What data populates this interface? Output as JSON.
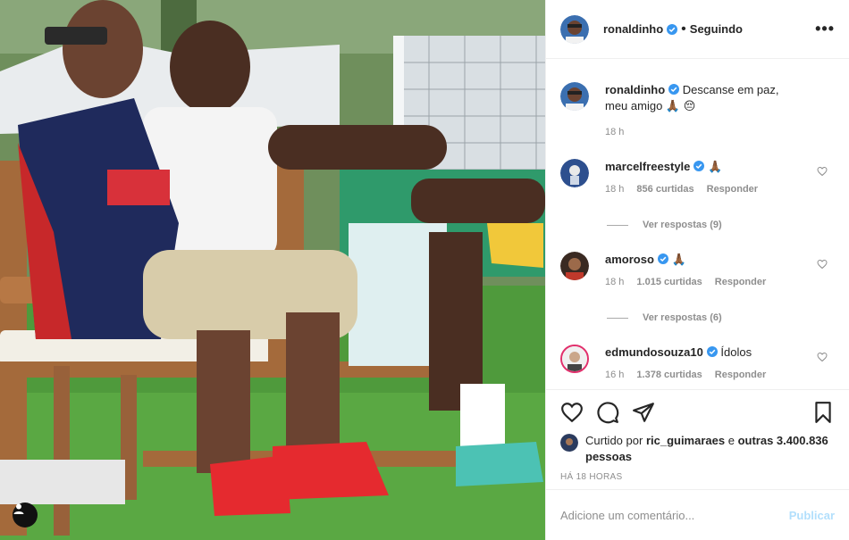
{
  "post": {
    "author": "ronaldinho",
    "follow_label": "Seguindo",
    "dot": "•",
    "more": "•••"
  },
  "comments": [
    {
      "user": "ronaldinho",
      "text": "Descanse em paz, meu amigo 🙏🏾 😔",
      "time": "18 h"
    },
    {
      "user": "marcelfreestyle",
      "text": "🙏🏾",
      "time": "18 h",
      "likes": "856 curtidas",
      "reply": "Responder",
      "view_replies": "Ver respostas (9)"
    },
    {
      "user": "amoroso",
      "text": "🙏🏾",
      "time": "18 h",
      "likes": "1.015 curtidas",
      "reply": "Responder",
      "view_replies": "Ver respostas (6)"
    },
    {
      "user": "edmundosouza10",
      "text": "Ídolos",
      "time": "16 h",
      "likes": "1.378 curtidas",
      "reply": "Responder"
    }
  ],
  "likes": {
    "prefix": "Curtido por",
    "user": "ric_guimaraes",
    "mid": "e",
    "others": "outras 3.400.836 pessoas"
  },
  "timestamp": "HÁ 18 HORAS",
  "add_comment": {
    "placeholder": "Adicione um comentário...",
    "publish": "Publicar"
  },
  "icons": {
    "like": "heart-icon",
    "comment": "comment-icon",
    "share": "share-icon",
    "save": "bookmark-icon",
    "verified": "verified-badge-icon",
    "tag": "user-tag-icon"
  },
  "colors": {
    "verified": "#3897f0",
    "publish_disabled": "#b2dffc",
    "muted": "#8e8e8e"
  }
}
